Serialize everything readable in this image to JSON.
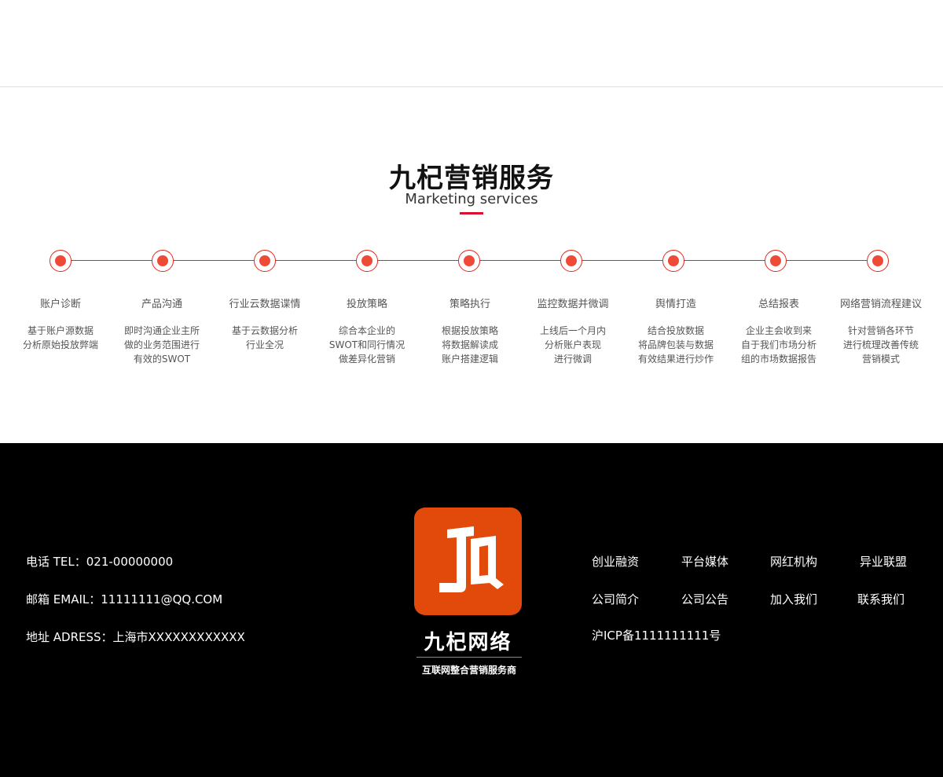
{
  "section": {
    "title": "九杞营销服务",
    "subtitle": "Marketing services",
    "accent_color": "#d7102b",
    "timeline_color": "#e2271d",
    "steps": [
      {
        "title": "账户诊断",
        "desc": [
          "基于账户源数据",
          "分析原始投放弊端"
        ]
      },
      {
        "title": "产品沟通",
        "desc": [
          "即时沟通企业主所",
          "做的业务范围进行",
          "有效的SWOT"
        ]
      },
      {
        "title": "行业云数据谍情",
        "desc": [
          "基于云数据分析",
          "行业全况"
        ]
      },
      {
        "title": "投放策略",
        "desc": [
          "综合本企业的",
          "SWOT和同行情况",
          "做差异化营销"
        ]
      },
      {
        "title": "策略执行",
        "desc": [
          "根据投放策略",
          "将数据解读成",
          "账户搭建逻辑"
        ]
      },
      {
        "title": "监控数据并微调",
        "desc": [
          "上线后一个月内",
          "分析账户表现",
          "进行微调"
        ]
      },
      {
        "title": "舆情打造",
        "desc": [
          "结合投放数据",
          "将品牌包装与数据",
          "有效结果进行炒作"
        ]
      },
      {
        "title": "总结报表",
        "desc": [
          "企业主会收到来",
          "自于我们市场分析",
          "组的市场数据报告"
        ]
      },
      {
        "title": "网络营销流程建议",
        "desc": [
          "针对营销各环节",
          "进行梳理改善传统",
          "营销模式"
        ]
      }
    ]
  },
  "footer": {
    "phone": "电话 TEL：021-00000000",
    "email": "邮箱 EMAIL：11111111@QQ.COM",
    "address": "地址 ADRESS：上海市XXXXXXXXXXXX",
    "logo_name": "九杞网络",
    "logo_tagline": "互联网整合营销服务商",
    "logo_letters": "JQ",
    "logo_color": "#e24a0c",
    "links": {
      "row1": [
        "创业融资",
        "平台媒体",
        "网红机构",
        "异业联盟"
      ],
      "row2": [
        "公司简介",
        "公司公告",
        "加入我们",
        "联系我们"
      ]
    },
    "icp": "沪ICP备1111111111号"
  }
}
